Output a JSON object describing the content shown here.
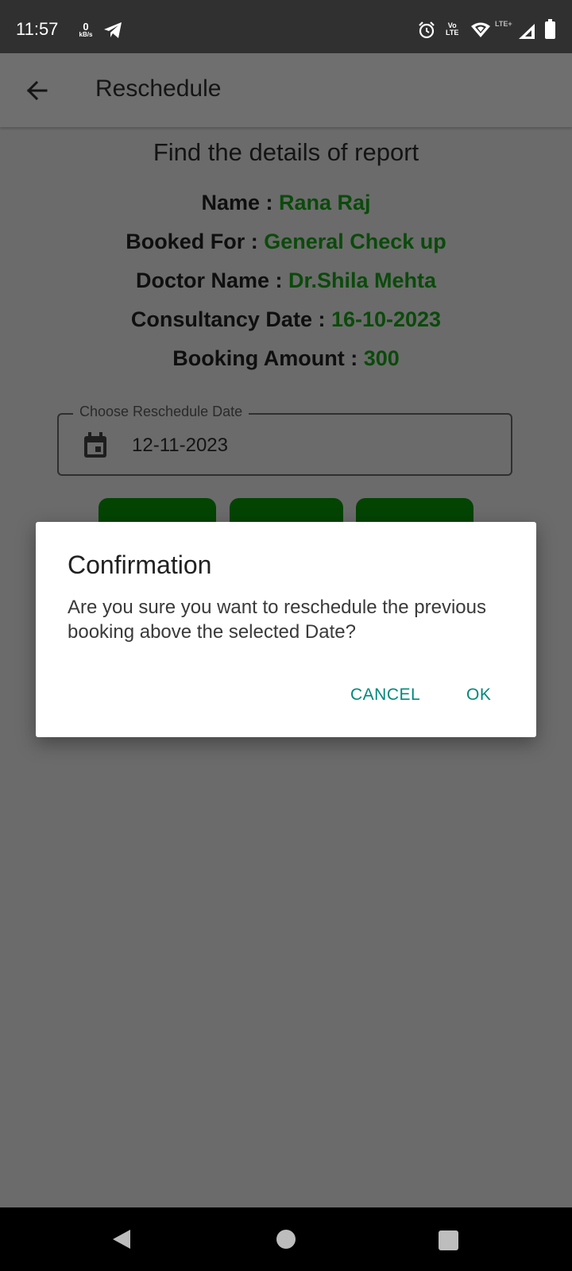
{
  "status_bar": {
    "time": "11:57",
    "net_speed_value": "0",
    "net_speed_unit": "kB/s",
    "volte_top": "Vo",
    "volte_bottom": "LTE",
    "lte_label": "LTE+"
  },
  "app_bar": {
    "title": "Reschedule"
  },
  "report": {
    "heading": "Find the details of report",
    "rows": [
      {
        "label": "Name : ",
        "value": "Rana Raj"
      },
      {
        "label": "Booked For : ",
        "value": "General Check up"
      },
      {
        "label": "Doctor Name : ",
        "value": "Dr.Shila Mehta"
      },
      {
        "label": "Consultancy Date : ",
        "value": "16-10-2023"
      },
      {
        "label": "Booking Amount : ",
        "value": "300"
      }
    ]
  },
  "date_field": {
    "label": "Choose Reschedule Date",
    "value": "12-11-2023"
  },
  "dialog": {
    "title": "Confirmation",
    "message": "Are you sure you want to reschedule the previous booking above the selected Date?",
    "cancel_label": "CANCEL",
    "ok_label": "OK"
  },
  "colors": {
    "accent": "#00897b",
    "value_green": "#0b4a0b",
    "slot_green": "#034403"
  }
}
